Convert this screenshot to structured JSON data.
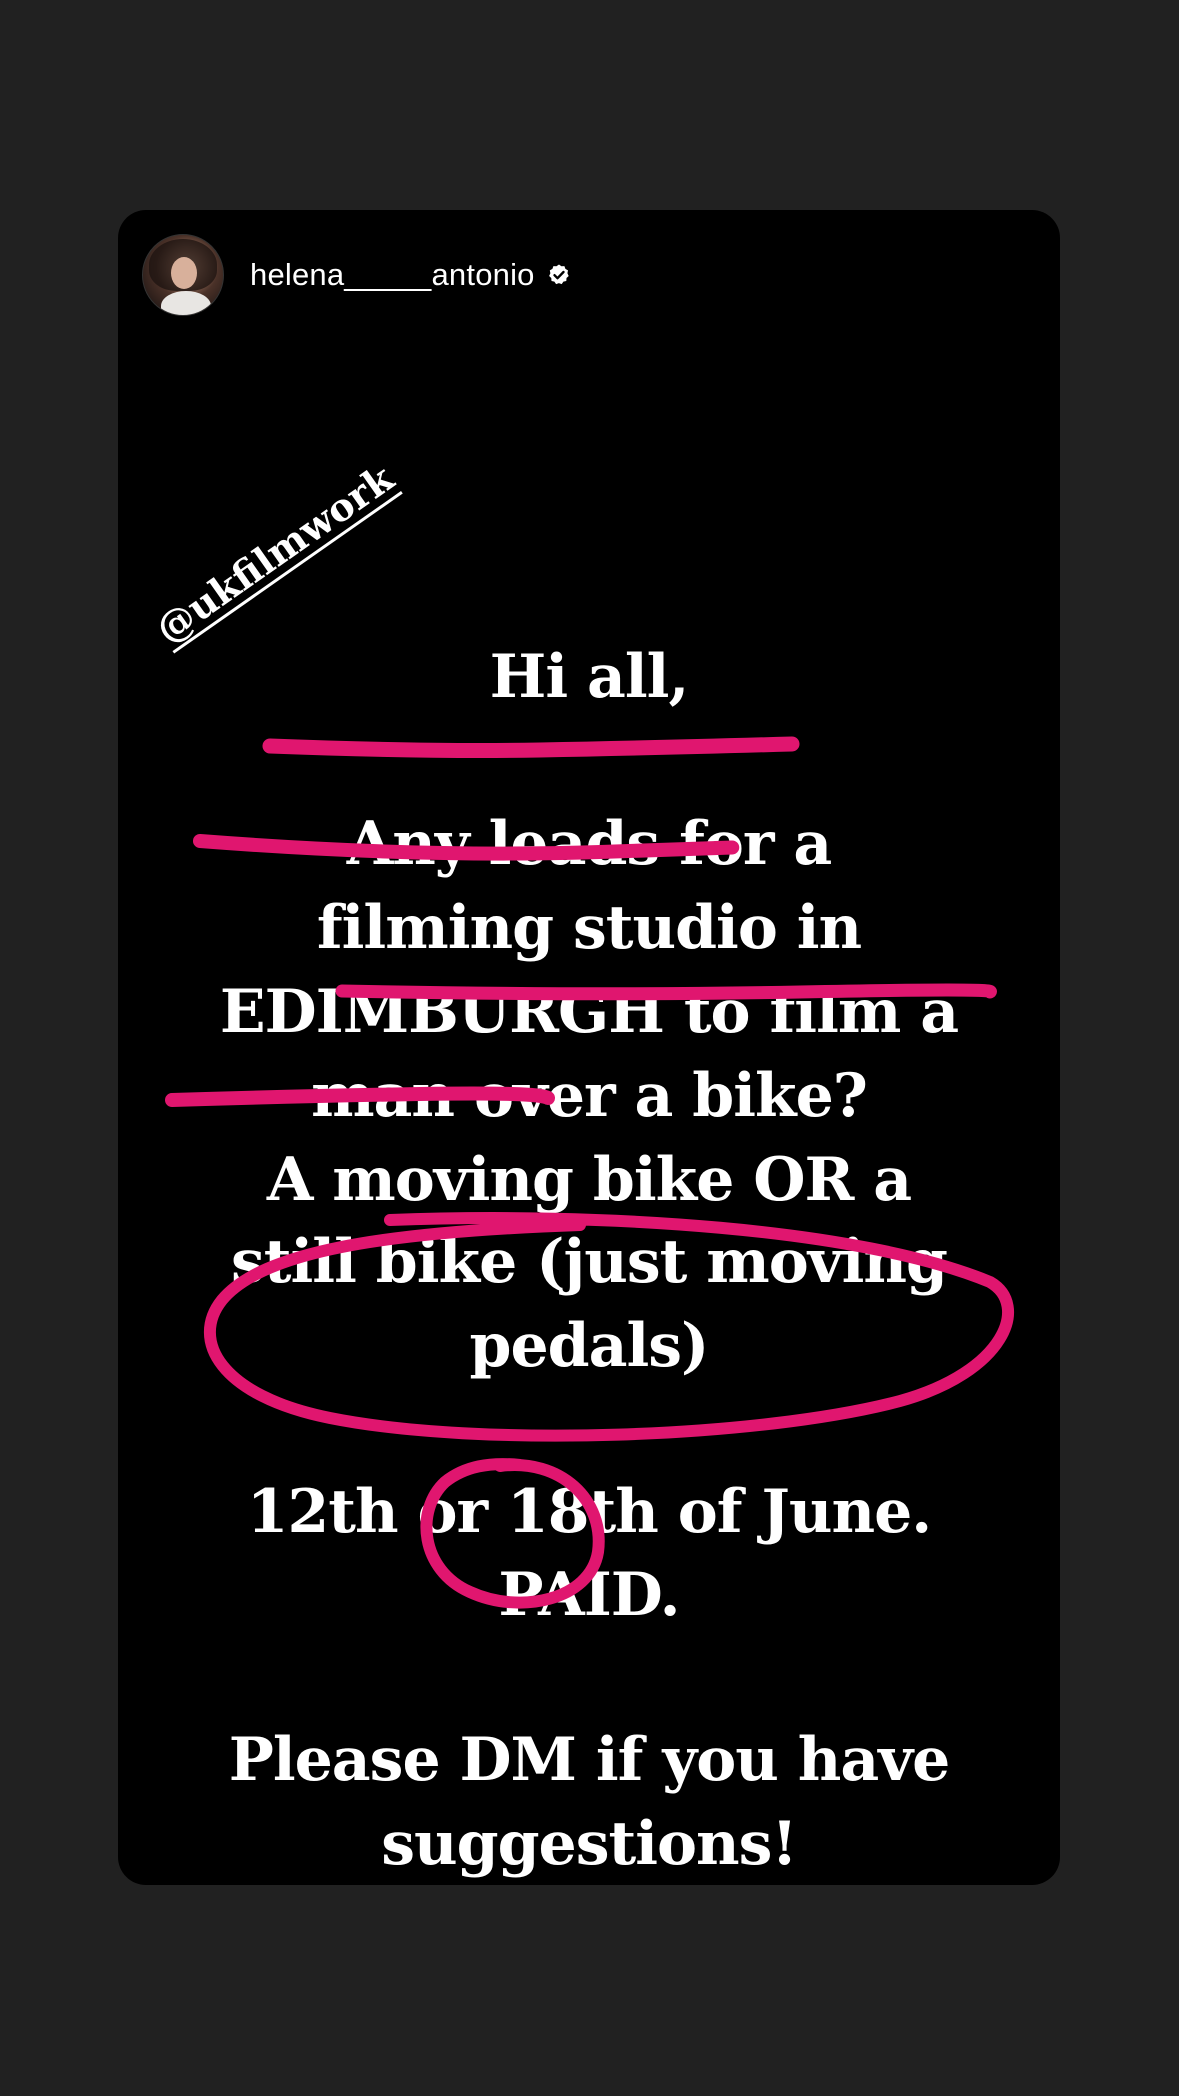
{
  "story": {
    "username": "helena_____antonio",
    "verified": true,
    "mention": "@ukfilmwork",
    "lines": [
      "Hi all,",
      "Any leads for a",
      "filming studio in",
      "EDIMBURGH to film a",
      "man over a bike?",
      "A moving bike OR a",
      "still bike (just moving",
      "pedals)",
      "12th or 18th of June.",
      "PAID.",
      "Please DM if  you have",
      "suggestions!"
    ]
  },
  "colors": {
    "background": "#212121",
    "card": "#000000",
    "text": "#ffffff",
    "highlight_marker": "#e0166f"
  },
  "icons": {
    "verified": "verified-badge-icon",
    "avatar": "profile-photo"
  }
}
